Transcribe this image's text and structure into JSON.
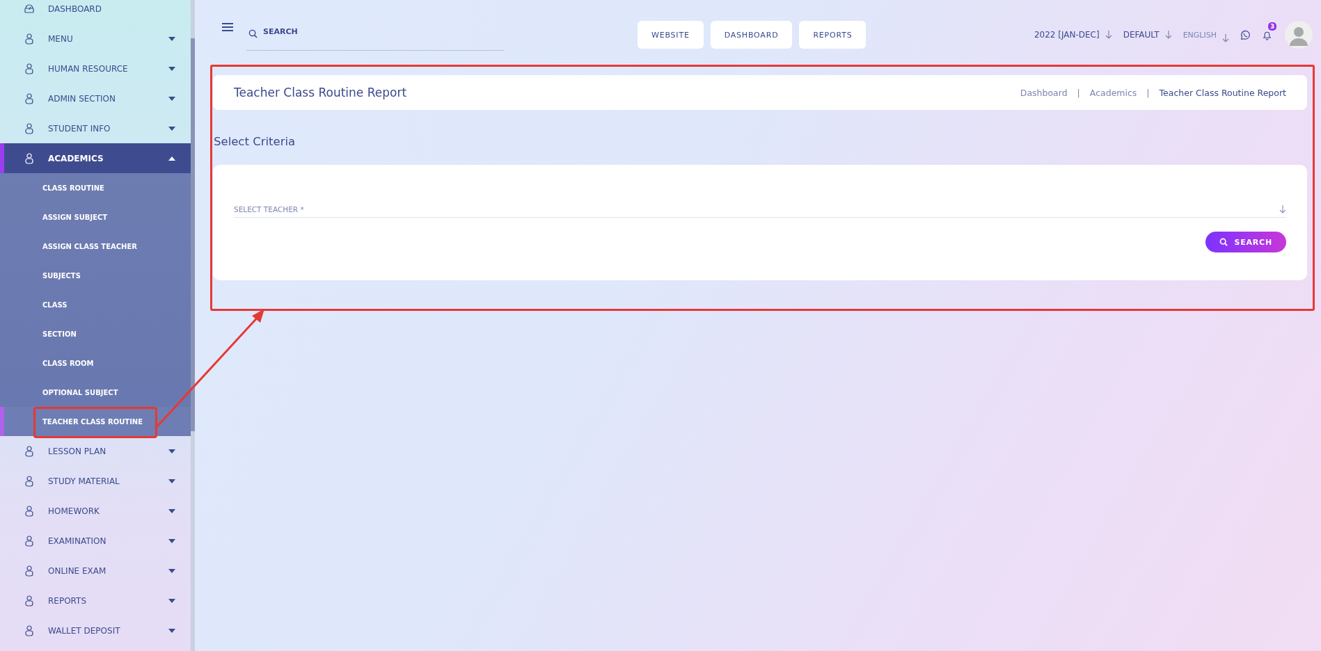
{
  "sidebar": {
    "items": [
      {
        "label": "DASHBOARD",
        "expandable": false,
        "selected": false
      },
      {
        "label": "MENU",
        "expandable": true,
        "expanded": false,
        "selected": false
      },
      {
        "label": "HUMAN RESOURCE",
        "expandable": true,
        "expanded": false,
        "selected": false
      },
      {
        "label": "ADMIN SECTION",
        "expandable": true,
        "expanded": false,
        "selected": false
      },
      {
        "label": "STUDENT INFO",
        "expandable": true,
        "expanded": false,
        "selected": false
      },
      {
        "label": "ACADEMICS",
        "expandable": true,
        "expanded": true,
        "selected": true,
        "children": [
          {
            "label": "CLASS ROUTINE",
            "selected": false
          },
          {
            "label": "ASSIGN SUBJECT",
            "selected": false
          },
          {
            "label": "ASSIGN CLASS TEACHER",
            "selected": false
          },
          {
            "label": "SUBJECTS",
            "selected": false
          },
          {
            "label": "CLASS",
            "selected": false
          },
          {
            "label": "SECTION",
            "selected": false
          },
          {
            "label": "CLASS ROOM",
            "selected": false
          },
          {
            "label": "OPTIONAL SUBJECT",
            "selected": false
          },
          {
            "label": "TEACHER CLASS ROUTINE",
            "selected": true
          }
        ]
      },
      {
        "label": "LESSON PLAN",
        "expandable": true,
        "expanded": false,
        "selected": false
      },
      {
        "label": "STUDY MATERIAL",
        "expandable": true,
        "expanded": false,
        "selected": false
      },
      {
        "label": "HOMEWORK",
        "expandable": true,
        "expanded": false,
        "selected": false
      },
      {
        "label": "EXAMINATION",
        "expandable": true,
        "expanded": false,
        "selected": false
      },
      {
        "label": "ONLINE EXAM",
        "expandable": true,
        "expanded": false,
        "selected": false
      },
      {
        "label": "REPORTS",
        "expandable": true,
        "expanded": false,
        "selected": false
      },
      {
        "label": "WALLET DEPOSIT",
        "expandable": true,
        "expanded": false,
        "selected": false
      }
    ]
  },
  "header": {
    "search": {
      "placeholder": "SEARCH"
    },
    "nav_buttons": [
      "WEBSITE",
      "DASHBOARD",
      "REPORTS"
    ],
    "session": "2022 [JAN-DEC]",
    "theme": "DEFAULT",
    "language": "ENGLISH",
    "notifications": "3"
  },
  "page": {
    "title": "Teacher Class Routine Report",
    "breadcrumbs": [
      {
        "label": "Dashboard",
        "current": false
      },
      {
        "label": "Academics",
        "current": false
      },
      {
        "label": "Teacher Class Routine Report",
        "current": true
      }
    ],
    "breadcrumb_separator": "|",
    "section_title": "Select Criteria",
    "form": {
      "field": {
        "placeholder": "SELECT TEACHER *"
      },
      "button": "SEARCH"
    }
  }
}
